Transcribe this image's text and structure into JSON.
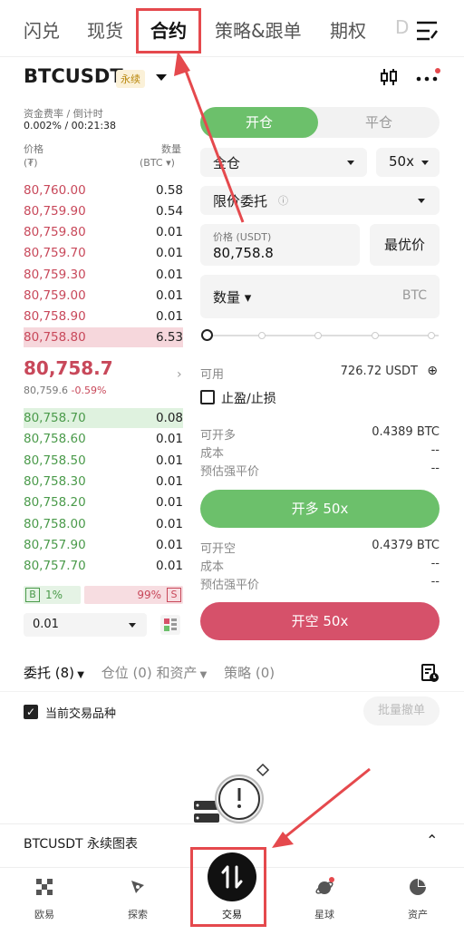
{
  "topnav": {
    "tabs": [
      "闪兑",
      "现货",
      "合约",
      "策略&跟单",
      "期权",
      "D"
    ]
  },
  "header": {
    "symbol": "BTCUSDT",
    "badge": "永续"
  },
  "funding": {
    "label": "资金费率 / 倒计时",
    "value": "0.002% / 00:21:38"
  },
  "orderbook": {
    "price_label": "价格",
    "price_unit": "(₮)",
    "qty_label": "数量",
    "qty_unit": "(BTC ▾)",
    "asks": [
      {
        "p": "80,760.00",
        "q": "0.58"
      },
      {
        "p": "80,759.90",
        "q": "0.54"
      },
      {
        "p": "80,759.80",
        "q": "0.01"
      },
      {
        "p": "80,759.70",
        "q": "0.01"
      },
      {
        "p": "80,759.30",
        "q": "0.01"
      },
      {
        "p": "80,759.00",
        "q": "0.01"
      },
      {
        "p": "80,758.90",
        "q": "0.01"
      },
      {
        "p": "80,758.80",
        "q": "6.53"
      }
    ],
    "last_price": "80,758.7",
    "mark_price": "80,759.6",
    "change": "-0.59%",
    "bids": [
      {
        "p": "80,758.70",
        "q": "0.08"
      },
      {
        "p": "80,758.60",
        "q": "0.01"
      },
      {
        "p": "80,758.50",
        "q": "0.01"
      },
      {
        "p": "80,758.30",
        "q": "0.01"
      },
      {
        "p": "80,758.20",
        "q": "0.01"
      },
      {
        "p": "80,758.00",
        "q": "0.01"
      },
      {
        "p": "80,757.90",
        "q": "0.01"
      },
      {
        "p": "80,757.70",
        "q": "0.01"
      }
    ],
    "buy_label": "B",
    "buy_pct": "1%",
    "sell_label": "S",
    "sell_pct": "99%",
    "buy_ratio": 0.36,
    "precision": "0.01"
  },
  "form": {
    "tab_open": "开仓",
    "tab_close": "平仓",
    "margin_mode": "全仓",
    "leverage": "50x",
    "order_type": "限价委托",
    "price_label": "价格 (USDT)",
    "price_value": "80,758.8",
    "best_price": "最优价",
    "qty_label": "数量 ▾",
    "qty_unit": "BTC",
    "avail_label": "可用",
    "avail_value": "726.72 USDT",
    "tpsl_label": "止盈/止损",
    "long": {
      "max_label": "可开多",
      "max_value": "0.4389 BTC",
      "cost_label": "成本",
      "cost_value": "--",
      "liq_label": "预估强平价",
      "liq_value": "--",
      "button": "开多 50x"
    },
    "short": {
      "max_label": "可开空",
      "max_value": "0.4379 BTC",
      "cost_label": "成本",
      "cost_value": "--",
      "liq_label": "预估强平价",
      "liq_value": "--",
      "button": "开空 50x"
    }
  },
  "orders": {
    "tab_orders": "委托 (8)",
    "tab_positions": "仓位 (0) 和资产",
    "tab_strategy": "策略 (0)",
    "filter_label": "当前交易品种",
    "batch_cancel": "批量撤单"
  },
  "chartbar": {
    "label": "BTCUSDT 永续图表"
  },
  "bottomnav": [
    "欧易",
    "探索",
    "交易",
    "星球",
    "资产"
  ],
  "colors": {
    "buy": "#6cc06b",
    "sell": "#d6516a",
    "highlight": "#e5494d"
  }
}
